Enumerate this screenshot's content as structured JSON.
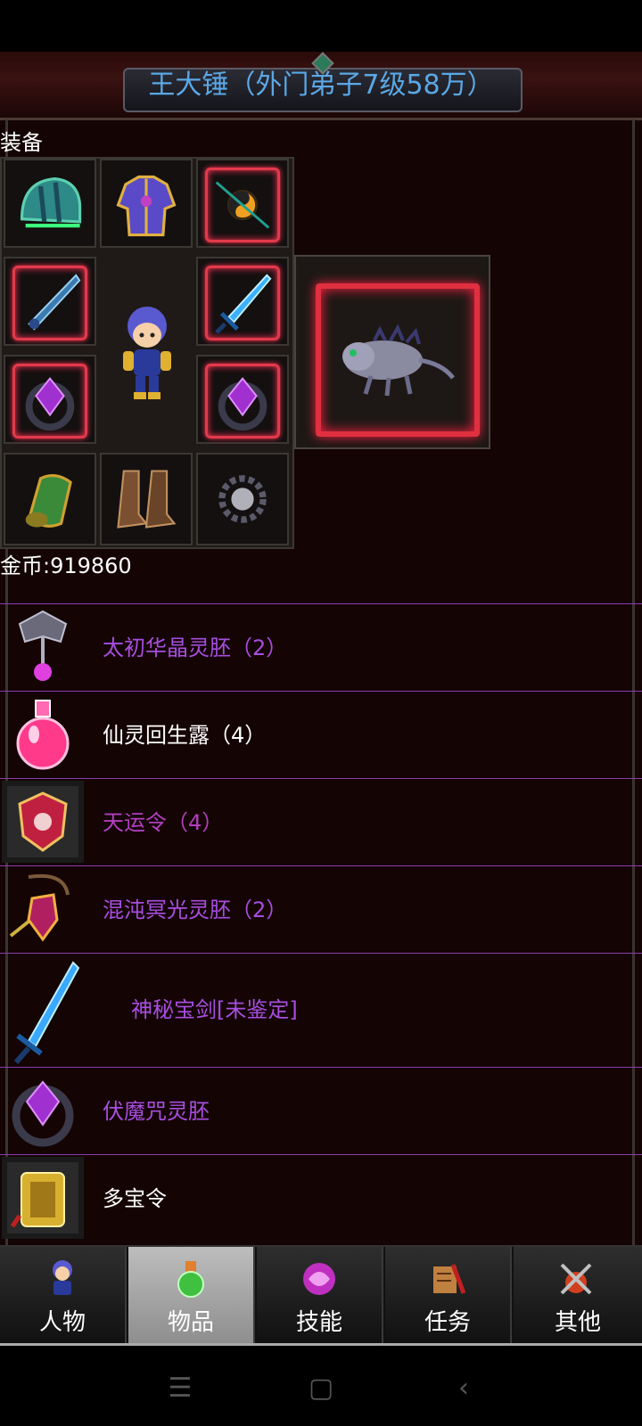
{
  "title": "王大锤（外门弟子7级58万）",
  "equipment_label": "装备",
  "gold_text": "金币:919860",
  "items": [
    {
      "name": "太初华晶灵胚（2）",
      "color": "#a84ee0"
    },
    {
      "name": "仙灵回生露（4）",
      "color": "#ffffff"
    },
    {
      "name": "天运令（4）",
      "color": "#b23ec0"
    },
    {
      "name": "混沌冥光灵胚（2）",
      "color": "#a84ee0"
    },
    {
      "name": "神秘宝剑[未鉴定]",
      "color": "#a84ee0"
    },
    {
      "name": "伏魔咒灵胚",
      "color": "#a84ee0"
    },
    {
      "name": "多宝令",
      "color": "#ffffff"
    }
  ],
  "tabs": [
    {
      "label": "人物"
    },
    {
      "label": "物品"
    },
    {
      "label": "技能"
    },
    {
      "label": "任务"
    },
    {
      "label": "其他"
    }
  ],
  "active_tab": "物品",
  "colors": {
    "title": "#5aa8e6",
    "item_border": "#8a3ea8",
    "rare_frame": "#e23a4a",
    "background": "#140404"
  }
}
